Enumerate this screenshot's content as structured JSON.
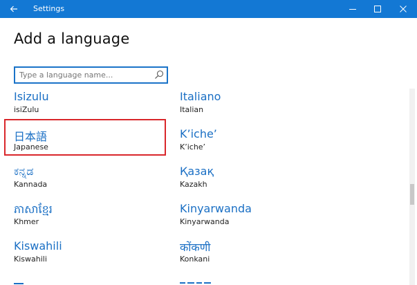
{
  "window": {
    "title": "Settings",
    "accent_color": "#1378d4"
  },
  "page": {
    "title": "Add a language"
  },
  "search": {
    "placeholder": "Type a language name..."
  },
  "languages": [
    {
      "native": "Isizulu",
      "english": "isiZulu"
    },
    {
      "native": "Italiano",
      "english": "Italian"
    },
    {
      "native": "日本語",
      "english": "Japanese",
      "selected": true
    },
    {
      "native": "K’iche’",
      "english": "K’iche’"
    },
    {
      "native": "ಕನ್ನಡ",
      "english": "Kannada"
    },
    {
      "native": "Қазақ",
      "english": "Kazakh"
    },
    {
      "native": "ភាសាខ្មែរ",
      "english": "Khmer"
    },
    {
      "native": "Kinyarwanda",
      "english": "Kinyarwanda"
    },
    {
      "native": "Kiswahili",
      "english": "Kiswahili"
    },
    {
      "native": "कोंकणी",
      "english": "Konkani"
    }
  ],
  "icons": {
    "back": "back-arrow-icon",
    "minimize": "minimize-icon",
    "maximize": "maximize-icon",
    "close": "close-icon",
    "search": "search-icon"
  },
  "selection_color": "#d9262a"
}
